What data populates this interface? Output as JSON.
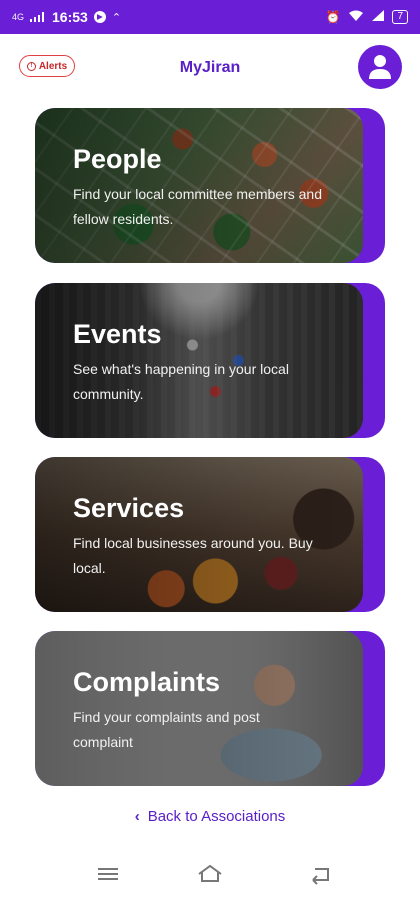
{
  "status_bar": {
    "network": "4G",
    "time": "16:53",
    "battery": "7"
  },
  "header": {
    "alerts_label": "Alerts",
    "title": "MyJiran",
    "avatar_icon": "user-icon"
  },
  "cards": [
    {
      "title": "People",
      "description": "Find your local committee members and fellow residents."
    },
    {
      "title": "Events",
      "description": "See what's happening in your local community."
    },
    {
      "title": "Services",
      "description": "Find local businesses around you. Buy local."
    },
    {
      "title": "Complaints",
      "description": "Find your complaints and post complaint"
    }
  ],
  "back_link": {
    "label": "Back to Associations"
  },
  "nav": {
    "menu_icon": "menu-icon",
    "home_icon": "home-icon",
    "back_icon": "back-icon"
  },
  "colors": {
    "accent": "#6a1fd6",
    "title": "#5a20c8",
    "alert": "#c62828"
  }
}
